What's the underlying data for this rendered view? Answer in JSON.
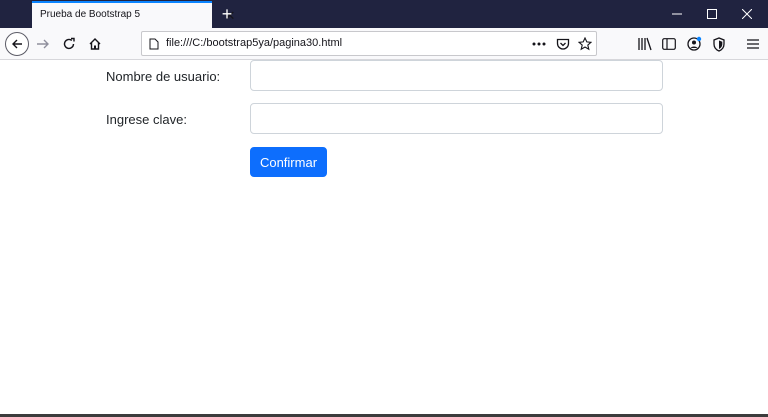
{
  "browser": {
    "tab_title": "Prueba de Bootstrap 5",
    "url": "file:///C:/bootstrap5ya/pagina30.html",
    "tab_close_glyph": "✕",
    "new_tab_glyph": "+",
    "window_controls": [
      "minimize",
      "maximize",
      "close"
    ],
    "nav_icons": [
      "back-icon",
      "forward-icon",
      "reload-icon",
      "home-icon"
    ],
    "url_icons": [
      "page-icon",
      "page-actions-icon",
      "pocket-icon",
      "bookmark-star-icon"
    ],
    "toolbar_icons": [
      "library-icon",
      "sidebar-icon",
      "account-icon",
      "shield-icon",
      "menu-icon"
    ],
    "accent_color": "#0a84ff"
  },
  "form": {
    "username_label": "Nombre de usuario:",
    "username_value": "",
    "password_label": "Ingrese clave:",
    "password_value": "",
    "submit_label": "Confirmar",
    "button_color": "#0d6efd"
  }
}
